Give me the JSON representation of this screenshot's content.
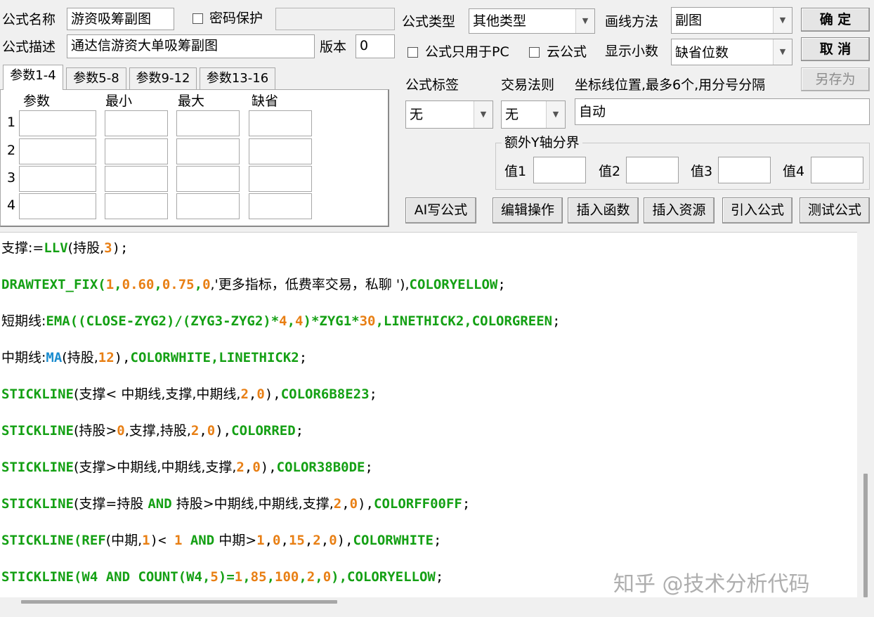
{
  "form": {
    "name_label": "公式名称",
    "name_value": "游资吸筹副图",
    "password_label": "密码保护",
    "desc_label": "公式描述",
    "desc_value": "通达信游资大单吸筹副图",
    "version_label": "版本",
    "version_value": "0",
    "type_label": "公式类型",
    "type_value": "其他类型",
    "draw_label": "画线方法",
    "draw_value": "副图",
    "pc_only_label": "公式只用于PC",
    "cloud_label": "云公式",
    "decimals_label": "显示小数",
    "decimals_value": "缺省位数",
    "tag_label": "公式标签",
    "tag_value": "无",
    "rule_label": "交易法则",
    "rule_value": "无",
    "axis_label": "坐标线位置,最多6个,用分号分隔",
    "axis_value": "自动",
    "yaxis_group": "额外Y轴分界",
    "v1": "值1",
    "v2": "值2",
    "v3": "值3",
    "v4": "值4"
  },
  "buttons": {
    "ok": "确  定",
    "cancel": "取  消",
    "save_as": "另存为",
    "ai": "AI写公式",
    "edit": "编辑操作",
    "insert_func": "插入函数",
    "insert_res": "插入资源",
    "import": "引入公式",
    "test": "测试公式"
  },
  "tabs": [
    "参数1-4",
    "参数5-8",
    "参数9-12",
    "参数13-16"
  ],
  "params": {
    "headers": [
      "参数",
      "最小",
      "最大",
      "缺省"
    ],
    "rows": [
      "1",
      "2",
      "3",
      "4"
    ]
  },
  "code": [
    [
      {
        "t": "支撑:=",
        "c": "k"
      },
      {
        "t": "LLV",
        "c": "g"
      },
      {
        "t": "(持股,",
        "c": "k"
      },
      {
        "t": "3",
        "c": "o"
      },
      {
        "t": ");",
        "c": "k"
      }
    ],
    [
      {
        "t": "DRAWTEXT_FIX(",
        "c": "g"
      },
      {
        "t": "1",
        "c": "o"
      },
      {
        "t": ",",
        "c": "g"
      },
      {
        "t": "0.60",
        "c": "o"
      },
      {
        "t": ",",
        "c": "g"
      },
      {
        "t": "0.75",
        "c": "o"
      },
      {
        "t": ",",
        "c": "g"
      },
      {
        "t": "0",
        "c": "o"
      },
      {
        "t": ",'更多指标，低费率交易，私聊 '),",
        "c": "k"
      },
      {
        "t": "COLORYELLOW",
        "c": "g"
      },
      {
        "t": ";",
        "c": "k"
      }
    ],
    [
      {
        "t": "短期线:",
        "c": "k"
      },
      {
        "t": "EMA((CLOSE-ZYG2)/(ZYG3-ZYG2)*",
        "c": "g"
      },
      {
        "t": "4",
        "c": "o"
      },
      {
        "t": ",",
        "c": "g"
      },
      {
        "t": "4",
        "c": "o"
      },
      {
        "t": ")*ZYG1*",
        "c": "g"
      },
      {
        "t": "30",
        "c": "o"
      },
      {
        "t": ",LINETHICK2,COLORGREEN",
        "c": "g"
      },
      {
        "t": ";",
        "c": "k"
      }
    ],
    [
      {
        "t": "中期线:",
        "c": "k"
      },
      {
        "t": "MA",
        "c": "b"
      },
      {
        "t": "(持股,",
        "c": "k"
      },
      {
        "t": "12",
        "c": "o"
      },
      {
        "t": "),",
        "c": "k"
      },
      {
        "t": "COLORWHITE,LINETHICK2",
        "c": "g"
      },
      {
        "t": ";",
        "c": "k"
      }
    ],
    [
      {
        "t": "STICKLINE",
        "c": "g"
      },
      {
        "t": "(支撑< 中期线,支撑,中期线,",
        "c": "k"
      },
      {
        "t": "2",
        "c": "o"
      },
      {
        "t": ",",
        "c": "k"
      },
      {
        "t": "0",
        "c": "o"
      },
      {
        "t": "),",
        "c": "k"
      },
      {
        "t": "COLOR6B8E23",
        "c": "g"
      },
      {
        "t": ";",
        "c": "k"
      }
    ],
    [
      {
        "t": "STICKLINE",
        "c": "g"
      },
      {
        "t": "(持股>",
        "c": "k"
      },
      {
        "t": "0",
        "c": "o"
      },
      {
        "t": ",支撑,持股,",
        "c": "k"
      },
      {
        "t": "2",
        "c": "o"
      },
      {
        "t": ",",
        "c": "k"
      },
      {
        "t": "0",
        "c": "o"
      },
      {
        "t": "),",
        "c": "k"
      },
      {
        "t": "COLORRED",
        "c": "g"
      },
      {
        "t": ";",
        "c": "k"
      }
    ],
    [
      {
        "t": "STICKLINE",
        "c": "g"
      },
      {
        "t": "(支撑>中期线,中期线,支撑,",
        "c": "k"
      },
      {
        "t": "2",
        "c": "o"
      },
      {
        "t": ",",
        "c": "k"
      },
      {
        "t": "0",
        "c": "o"
      },
      {
        "t": "),",
        "c": "k"
      },
      {
        "t": "COLOR38B0DE",
        "c": "g"
      },
      {
        "t": ";",
        "c": "k"
      }
    ],
    [
      {
        "t": "STICKLINE",
        "c": "g"
      },
      {
        "t": "(支撑=持股 ",
        "c": "k"
      },
      {
        "t": "AND",
        "c": "g"
      },
      {
        "t": " 持股>中期线,中期线,支撑,",
        "c": "k"
      },
      {
        "t": "2",
        "c": "o"
      },
      {
        "t": ",",
        "c": "k"
      },
      {
        "t": "0",
        "c": "o"
      },
      {
        "t": "),",
        "c": "k"
      },
      {
        "t": "COLORFF00FF",
        "c": "g"
      },
      {
        "t": ";",
        "c": "k"
      }
    ],
    [
      {
        "t": "STICKLINE(REF",
        "c": "g"
      },
      {
        "t": "(中期,",
        "c": "k"
      },
      {
        "t": "1",
        "c": "o"
      },
      {
        "t": ")< ",
        "c": "k"
      },
      {
        "t": "1",
        "c": "o"
      },
      {
        "t": " AND",
        "c": "g"
      },
      {
        "t": " 中期>",
        "c": "k"
      },
      {
        "t": "1",
        "c": "o"
      },
      {
        "t": ",",
        "c": "k"
      },
      {
        "t": "0",
        "c": "o"
      },
      {
        "t": ",",
        "c": "k"
      },
      {
        "t": "15",
        "c": "o"
      },
      {
        "t": ",",
        "c": "k"
      },
      {
        "t": "2",
        "c": "o"
      },
      {
        "t": ",",
        "c": "k"
      },
      {
        "t": "0",
        "c": "o"
      },
      {
        "t": "),",
        "c": "k"
      },
      {
        "t": "COLORWHITE",
        "c": "g"
      },
      {
        "t": ";",
        "c": "k"
      }
    ],
    [
      {
        "t": "STICKLINE(W4 AND COUNT(W4,",
        "c": "g"
      },
      {
        "t": "5",
        "c": "o"
      },
      {
        "t": ")=",
        "c": "g"
      },
      {
        "t": "1",
        "c": "o"
      },
      {
        "t": ",",
        "c": "g"
      },
      {
        "t": "85",
        "c": "o"
      },
      {
        "t": ",",
        "c": "g"
      },
      {
        "t": "100",
        "c": "o"
      },
      {
        "t": ",",
        "c": "g"
      },
      {
        "t": "2",
        "c": "o"
      },
      {
        "t": ",",
        "c": "g"
      },
      {
        "t": "0",
        "c": "o"
      },
      {
        "t": "),COLORYELLOW",
        "c": "g"
      },
      {
        "t": ";",
        "c": "k"
      }
    ]
  ],
  "watermark": "知乎 @技术分析代码",
  "colors": {
    "keyword": "#14a014",
    "number": "#e87f14",
    "func": "#1a8ccf"
  }
}
